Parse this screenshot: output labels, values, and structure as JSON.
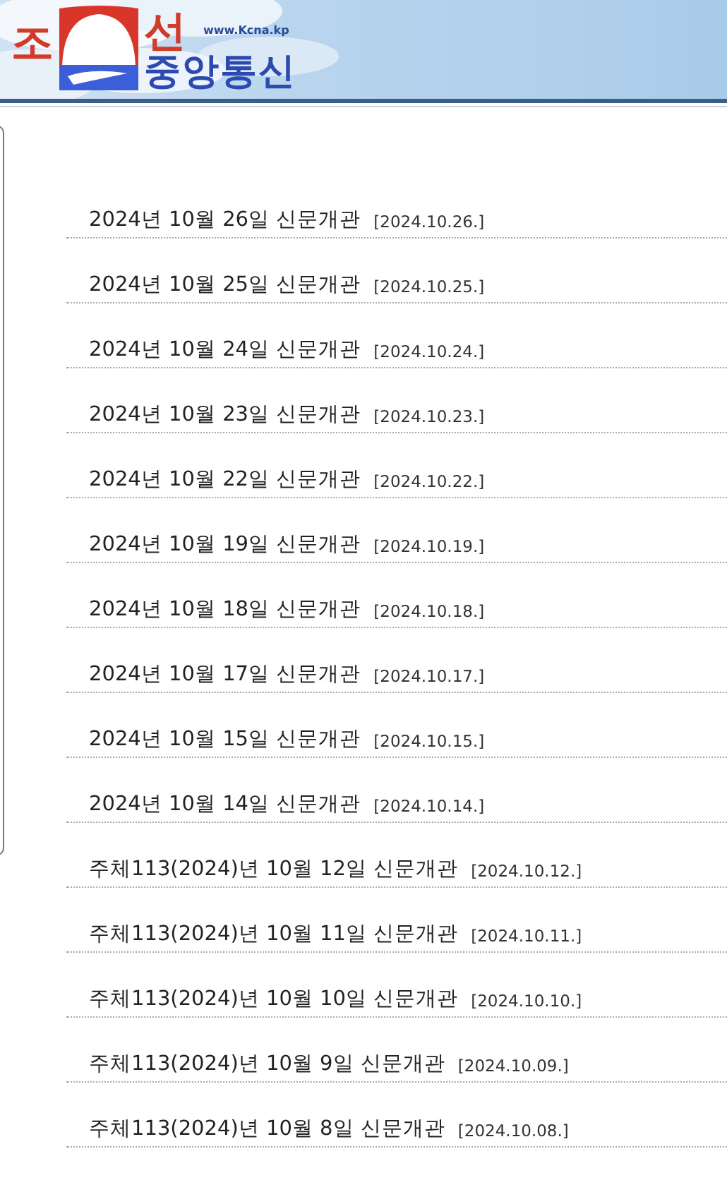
{
  "header": {
    "logo_top_left": "조",
    "logo_top_right": "선",
    "website": "www.Kcna.kp",
    "logo_bottom": "중앙통신"
  },
  "articles": [
    {
      "title": "2024년 10월 26일 신문개관",
      "date": "[2024.10.26.]"
    },
    {
      "title": "2024년 10월 25일 신문개관",
      "date": "[2024.10.25.]"
    },
    {
      "title": "2024년 10월 24일 신문개관",
      "date": "[2024.10.24.]"
    },
    {
      "title": "2024년 10월 23일 신문개관",
      "date": "[2024.10.23.]"
    },
    {
      "title": "2024년 10월 22일 신문개관",
      "date": "[2024.10.22.]"
    },
    {
      "title": "2024년 10월 19일 신문개관",
      "date": "[2024.10.19.]"
    },
    {
      "title": "2024년 10월 18일 신문개관",
      "date": "[2024.10.18.]"
    },
    {
      "title": "2024년 10월 17일 신문개관",
      "date": "[2024.10.17.]"
    },
    {
      "title": "2024년 10월 15일 신문개관",
      "date": "[2024.10.15.]"
    },
    {
      "title": "2024년 10월 14일 신문개관",
      "date": "[2024.10.14.]"
    },
    {
      "title": "주체113(2024)년 10월 12일 신문개관",
      "date": "[2024.10.12.]"
    },
    {
      "title": "주체113(2024)년 10월 11일 신문개관",
      "date": "[2024.10.11.]"
    },
    {
      "title": "주체113(2024)년 10월 10일 신문개관",
      "date": "[2024.10.10.]"
    },
    {
      "title": "주체113(2024)년 10월 9일 신문개관",
      "date": "[2024.10.09.]"
    },
    {
      "title": "주체113(2024)년 10월 8일 신문개관",
      "date": "[2024.10.08.]"
    }
  ]
}
